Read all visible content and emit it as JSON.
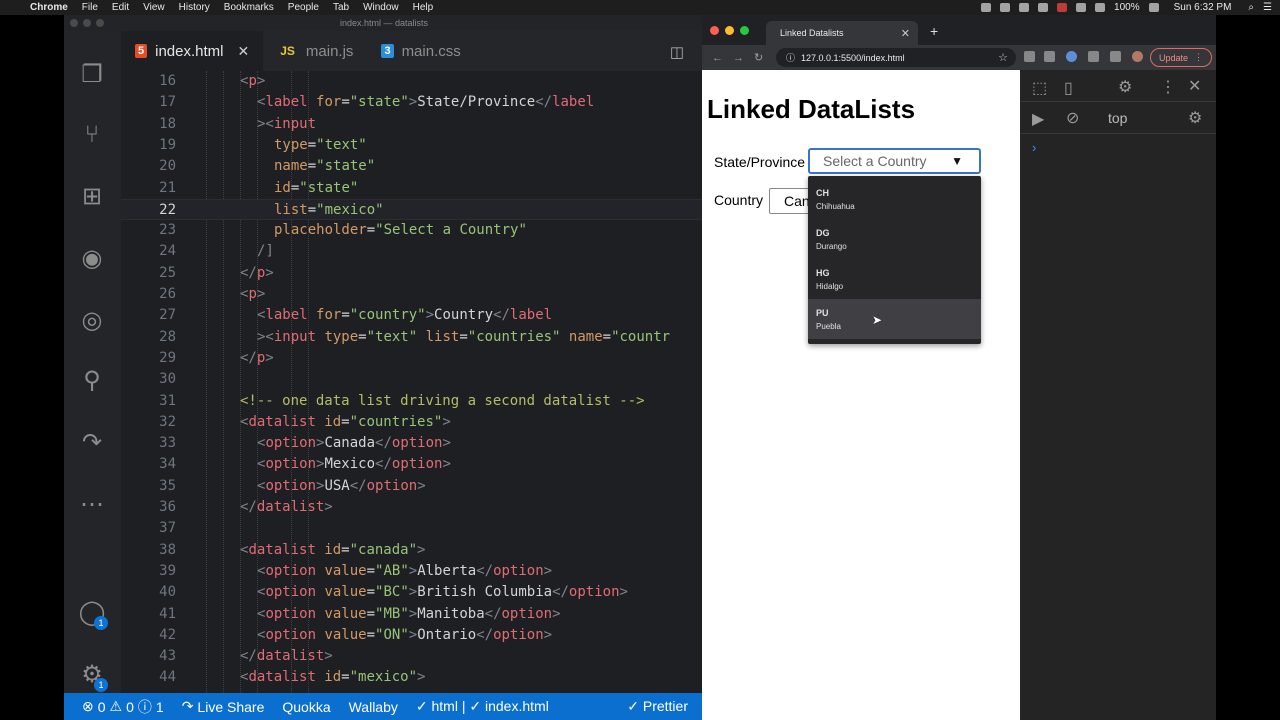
{
  "menubar": {
    "app": "Chrome",
    "items": [
      "File",
      "Edit",
      "View",
      "History",
      "Bookmarks",
      "People",
      "Tab",
      "Window",
      "Help"
    ],
    "battery": "100%",
    "clock": "Sun 6:32 PM"
  },
  "vscode": {
    "window_title": "index.html — datalists",
    "tabs": [
      {
        "icon": "5",
        "label": "index.html"
      },
      {
        "icon": "JS",
        "label": "main.js"
      },
      {
        "icon": "3",
        "label": "main.css"
      }
    ],
    "activity_badges": {
      "accounts": "1",
      "settings": "1"
    },
    "status": {
      "problems": "0",
      "warnings": "0",
      "info": "1",
      "live_share": "Live Share",
      "quokka": "Quokka",
      "wallaby": "Wallaby",
      "html_check": "✓ html | ✓ index.html",
      "prettier": "✓ Prettier"
    }
  },
  "code_lines": [
    {
      "n": "16",
      "indent": 4,
      "segs": [
        [
          "br",
          "<"
        ],
        [
          "tag",
          "p"
        ],
        [
          "br",
          ">"
        ]
      ]
    },
    {
      "n": "17",
      "indent": 6,
      "segs": [
        [
          "br",
          "<"
        ],
        [
          "tag",
          "label "
        ],
        [
          "attr",
          "for"
        ],
        [
          "txt",
          "="
        ],
        [
          "str",
          "\"state\""
        ],
        [
          "br",
          ">"
        ],
        [
          "txt",
          "State/Province"
        ],
        [
          "br",
          "</"
        ],
        [
          "tag",
          "label"
        ]
      ]
    },
    {
      "n": "18",
      "indent": 6,
      "segs": [
        [
          "br",
          "><"
        ],
        [
          "tag",
          "input"
        ]
      ]
    },
    {
      "n": "19",
      "indent": 8,
      "segs": [
        [
          "attr",
          "type"
        ],
        [
          "txt",
          "="
        ],
        [
          "str",
          "\"text\""
        ]
      ]
    },
    {
      "n": "20",
      "indent": 8,
      "segs": [
        [
          "attr",
          "name"
        ],
        [
          "txt",
          "="
        ],
        [
          "str",
          "\"state\""
        ]
      ]
    },
    {
      "n": "21",
      "indent": 8,
      "segs": [
        [
          "attr",
          "id"
        ],
        [
          "txt",
          "="
        ],
        [
          "str",
          "\"state\""
        ]
      ]
    },
    {
      "n": "22",
      "indent": 8,
      "segs": [
        [
          "attr",
          "list"
        ],
        [
          "txt",
          "="
        ],
        [
          "str",
          "\"mexico\""
        ]
      ]
    },
    {
      "n": "23",
      "indent": 8,
      "segs": [
        [
          "attr",
          "placeholder"
        ],
        [
          "txt",
          "="
        ],
        [
          "str",
          "\"Select a Country\""
        ]
      ]
    },
    {
      "n": "24",
      "indent": 6,
      "segs": [
        [
          "br",
          "/"
        ],
        [
          "br",
          "]"
        ]
      ]
    },
    {
      "n": "25",
      "indent": 4,
      "segs": [
        [
          "br",
          "</"
        ],
        [
          "tag",
          "p"
        ],
        [
          "br",
          ">"
        ]
      ]
    },
    {
      "n": "26",
      "indent": 4,
      "segs": [
        [
          "br",
          "<"
        ],
        [
          "tag",
          "p"
        ],
        [
          "br",
          ">"
        ]
      ]
    },
    {
      "n": "27",
      "indent": 6,
      "segs": [
        [
          "br",
          "<"
        ],
        [
          "tag",
          "label "
        ],
        [
          "attr",
          "for"
        ],
        [
          "txt",
          "="
        ],
        [
          "str",
          "\"country\""
        ],
        [
          "br",
          ">"
        ],
        [
          "txt",
          "Country"
        ],
        [
          "br",
          "</"
        ],
        [
          "tag",
          "label"
        ]
      ]
    },
    {
      "n": "28",
      "indent": 6,
      "segs": [
        [
          "br",
          "><"
        ],
        [
          "tag",
          "input "
        ],
        [
          "attr",
          "type"
        ],
        [
          "txt",
          "="
        ],
        [
          "str",
          "\"text\" "
        ],
        [
          "attr",
          "list"
        ],
        [
          "txt",
          "="
        ],
        [
          "str",
          "\"countries\" "
        ],
        [
          "attr",
          "name"
        ],
        [
          "txt",
          "="
        ],
        [
          "str",
          "\"countr"
        ]
      ]
    },
    {
      "n": "29",
      "indent": 4,
      "segs": [
        [
          "br",
          "</"
        ],
        [
          "tag",
          "p"
        ],
        [
          "br",
          ">"
        ]
      ]
    },
    {
      "n": "30",
      "indent": 0,
      "segs": []
    },
    {
      "n": "31",
      "indent": 4,
      "segs": [
        [
          "cm",
          "<!-- one data list driving a second datalist -->"
        ]
      ]
    },
    {
      "n": "32",
      "indent": 4,
      "segs": [
        [
          "br",
          "<"
        ],
        [
          "tag",
          "datalist "
        ],
        [
          "attr",
          "id"
        ],
        [
          "txt",
          "="
        ],
        [
          "str",
          "\"countries\""
        ],
        [
          "br",
          ">"
        ]
      ]
    },
    {
      "n": "33",
      "indent": 6,
      "segs": [
        [
          "br",
          "<"
        ],
        [
          "tag",
          "option"
        ],
        [
          "br",
          ">"
        ],
        [
          "txt",
          "Canada"
        ],
        [
          "br",
          "</"
        ],
        [
          "tag",
          "option"
        ],
        [
          "br",
          ">"
        ]
      ]
    },
    {
      "n": "34",
      "indent": 6,
      "segs": [
        [
          "br",
          "<"
        ],
        [
          "tag",
          "option"
        ],
        [
          "br",
          ">"
        ],
        [
          "txt",
          "Mexico"
        ],
        [
          "br",
          "</"
        ],
        [
          "tag",
          "option"
        ],
        [
          "br",
          ">"
        ]
      ]
    },
    {
      "n": "35",
      "indent": 6,
      "segs": [
        [
          "br",
          "<"
        ],
        [
          "tag",
          "option"
        ],
        [
          "br",
          ">"
        ],
        [
          "txt",
          "USA"
        ],
        [
          "br",
          "</"
        ],
        [
          "tag",
          "option"
        ],
        [
          "br",
          ">"
        ]
      ]
    },
    {
      "n": "36",
      "indent": 4,
      "segs": [
        [
          "br",
          "</"
        ],
        [
          "tag",
          "datalist"
        ],
        [
          "br",
          ">"
        ]
      ]
    },
    {
      "n": "37",
      "indent": 0,
      "segs": []
    },
    {
      "n": "38",
      "indent": 4,
      "segs": [
        [
          "br",
          "<"
        ],
        [
          "tag",
          "datalist "
        ],
        [
          "attr",
          "id"
        ],
        [
          "txt",
          "="
        ],
        [
          "str",
          "\"canada\""
        ],
        [
          "br",
          ">"
        ]
      ]
    },
    {
      "n": "39",
      "indent": 6,
      "segs": [
        [
          "br",
          "<"
        ],
        [
          "tag",
          "option "
        ],
        [
          "attr",
          "value"
        ],
        [
          "txt",
          "="
        ],
        [
          "str",
          "\"AB\""
        ],
        [
          "br",
          ">"
        ],
        [
          "txt",
          "Alberta"
        ],
        [
          "br",
          "</"
        ],
        [
          "tag",
          "option"
        ],
        [
          "br",
          ">"
        ]
      ]
    },
    {
      "n": "40",
      "indent": 6,
      "segs": [
        [
          "br",
          "<"
        ],
        [
          "tag",
          "option "
        ],
        [
          "attr",
          "value"
        ],
        [
          "txt",
          "="
        ],
        [
          "str",
          "\"BC\""
        ],
        [
          "br",
          ">"
        ],
        [
          "txt",
          "British Columbia"
        ],
        [
          "br",
          "</"
        ],
        [
          "tag",
          "option"
        ],
        [
          "br",
          ">"
        ]
      ]
    },
    {
      "n": "41",
      "indent": 6,
      "segs": [
        [
          "br",
          "<"
        ],
        [
          "tag",
          "option "
        ],
        [
          "attr",
          "value"
        ],
        [
          "txt",
          "="
        ],
        [
          "str",
          "\"MB\""
        ],
        [
          "br",
          ">"
        ],
        [
          "txt",
          "Manitoba"
        ],
        [
          "br",
          "</"
        ],
        [
          "tag",
          "option"
        ],
        [
          "br",
          ">"
        ]
      ]
    },
    {
      "n": "42",
      "indent": 6,
      "segs": [
        [
          "br",
          "<"
        ],
        [
          "tag",
          "option "
        ],
        [
          "attr",
          "value"
        ],
        [
          "txt",
          "="
        ],
        [
          "str",
          "\"ON\""
        ],
        [
          "br",
          ">"
        ],
        [
          "txt",
          "Ontario"
        ],
        [
          "br",
          "</"
        ],
        [
          "tag",
          "option"
        ],
        [
          "br",
          ">"
        ]
      ]
    },
    {
      "n": "43",
      "indent": 4,
      "segs": [
        [
          "br",
          "</"
        ],
        [
          "tag",
          "datalist"
        ],
        [
          "br",
          ">"
        ]
      ]
    },
    {
      "n": "44",
      "indent": 4,
      "segs": [
        [
          "br",
          "<"
        ],
        [
          "tag",
          "datalist "
        ],
        [
          "attr",
          "id"
        ],
        [
          "txt",
          "="
        ],
        [
          "str",
          "\"mexico\""
        ],
        [
          "br",
          ">"
        ]
      ]
    }
  ],
  "current_line": "22",
  "chrome": {
    "tab_title": "Linked Datalists",
    "url": "127.0.0.1:5500/index.html",
    "update_label": "Update"
  },
  "webpage": {
    "heading": "Linked DataLists",
    "state_label": "State/Province",
    "state_placeholder": "Select a Country",
    "country_label": "Country",
    "country_value": "Canada",
    "dropdown_options": [
      {
        "value": "CH",
        "label": "Chihuahua"
      },
      {
        "value": "DG",
        "label": "Durango"
      },
      {
        "value": "HG",
        "label": "Hidalgo"
      },
      {
        "value": "PU",
        "label": "Puebla"
      }
    ],
    "hovered_option": "PU"
  },
  "devtools": {
    "context": "top"
  },
  "colors": {
    "statusbar": "#0a6fcf",
    "focus_border": "#3b73c8",
    "dropdown_bg": "#262629"
  }
}
